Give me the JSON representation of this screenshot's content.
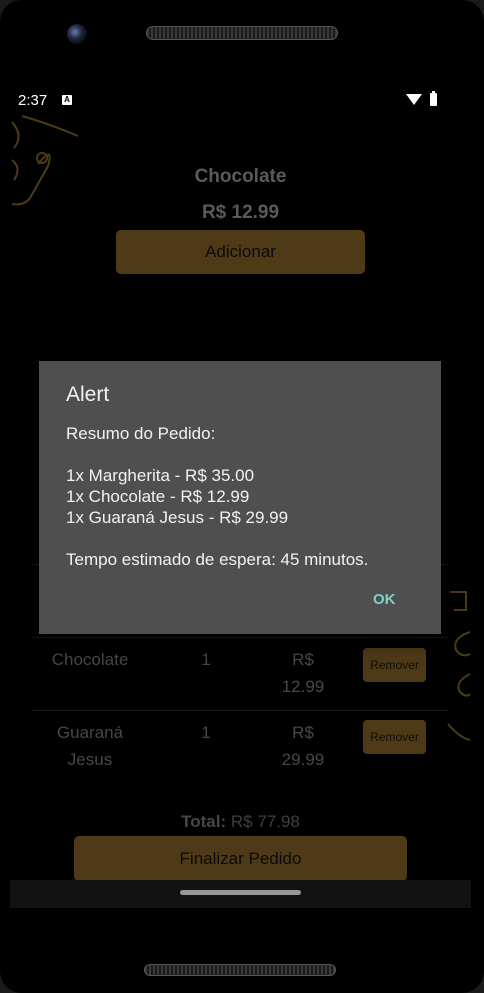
{
  "status_bar": {
    "time": "2:37",
    "notification_glyph": "A",
    "icons": [
      "wifi-icon",
      "battery-icon"
    ]
  },
  "product": {
    "name": "Chocolate",
    "price": "R$ 12.99",
    "add_label": "Adicionar"
  },
  "cart": {
    "items": [
      {
        "name": "Chocolate",
        "qty": "1",
        "currency": "R$",
        "amount": "12.99",
        "remove_label": "Remover"
      },
      {
        "name_line1": "Guaraná",
        "name_line2": "Jesus",
        "qty": "1",
        "currency": "R$",
        "amount": "29.99",
        "remove_label": "Remover"
      }
    ],
    "total_label": "Total:",
    "total_value": "R$ 77.98",
    "finalize_label": "Finalizar Pedido"
  },
  "dialog": {
    "title": "Alert",
    "summary_heading": "Resumo do Pedido:",
    "lines": [
      "1x Margherita - R$ 35.00",
      "1x Chocolate - R$ 12.99",
      "1x Guaraná Jesus - R$ 29.99"
    ],
    "wait_time": "Tempo estimado de espera: 45 minutos.",
    "ok_label": "OK"
  },
  "colors": {
    "accent": "#7a5a26",
    "dialog_bg": "#4f4f4f",
    "ok_text": "#7ecfc4",
    "background": "#000000"
  }
}
